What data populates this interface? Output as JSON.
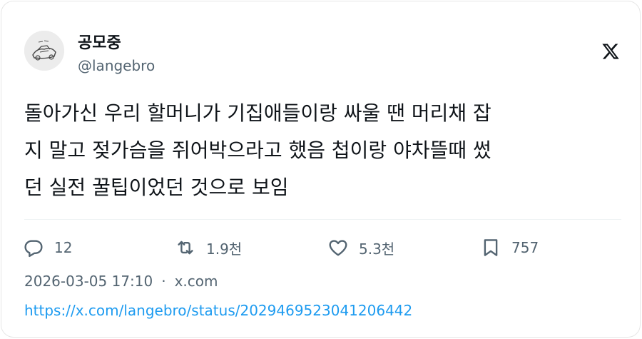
{
  "author": {
    "display_name": "공모중",
    "handle": "@langebro"
  },
  "tweet": {
    "lines": [
      "돌아가신 우리 할머니가 기집애들이랑 싸울 땐 머리채 잡",
      "지 말고 젖가슴을 쥐어박으라고 했음 첩이랑 야차뜰때 썼",
      "던 실전 꿀팁이었던 것으로 보임"
    ]
  },
  "actions": {
    "replies": "12",
    "retweets": "1.9천",
    "likes": "5.3천",
    "bookmarks": "757"
  },
  "meta": {
    "timestamp": "2026-03-05 17:10",
    "separator": "·",
    "source": "x.com"
  },
  "url": "https://x.com/langebro/status/2029469523041206442",
  "icons": {
    "platform": "x-logo-icon",
    "reply": "reply-icon",
    "retweet": "retweet-icon",
    "like": "heart-icon",
    "bookmark": "bookmark-icon"
  },
  "colors": {
    "text": "#0f1419",
    "secondary": "#536471",
    "link": "#1d9bf0"
  }
}
